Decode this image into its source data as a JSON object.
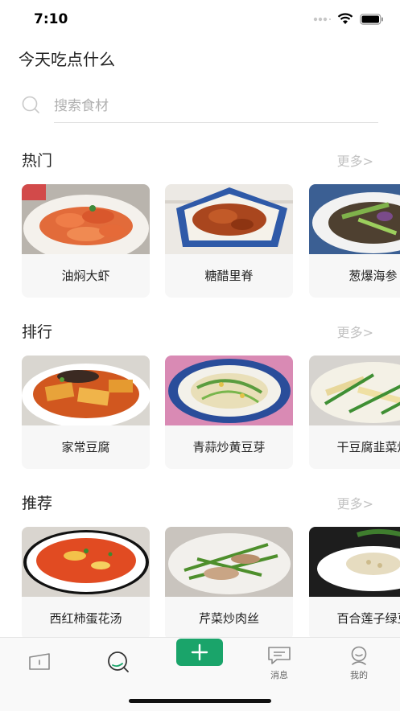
{
  "status_bar": {
    "time": "7:10"
  },
  "header": {
    "title": "今天吃点什么"
  },
  "search": {
    "placeholder": "搜索食材"
  },
  "sections": [
    {
      "title": "热门",
      "more": "更多>",
      "items": [
        "油焖大虾",
        "糖醋里脊",
        "葱爆海参"
      ]
    },
    {
      "title": "排行",
      "more": "更多>",
      "items": [
        "家常豆腐",
        "青蒜炒黄豆芽",
        "干豆腐韭菜炒"
      ]
    },
    {
      "title": "推荐",
      "more": "更多>",
      "items": [
        "西红柿蛋花汤",
        "芹菜炒肉丝",
        "百合莲子绿豆"
      ]
    }
  ],
  "tabbar": {
    "items": [
      {
        "icon": "home-icon",
        "label": ""
      },
      {
        "icon": "discover-icon",
        "label": ""
      },
      {
        "icon": "message-icon",
        "label": "消息"
      },
      {
        "icon": "profile-icon",
        "label": "我的"
      }
    ],
    "add_icon": "plus-icon",
    "accent": "#1aa46a"
  }
}
